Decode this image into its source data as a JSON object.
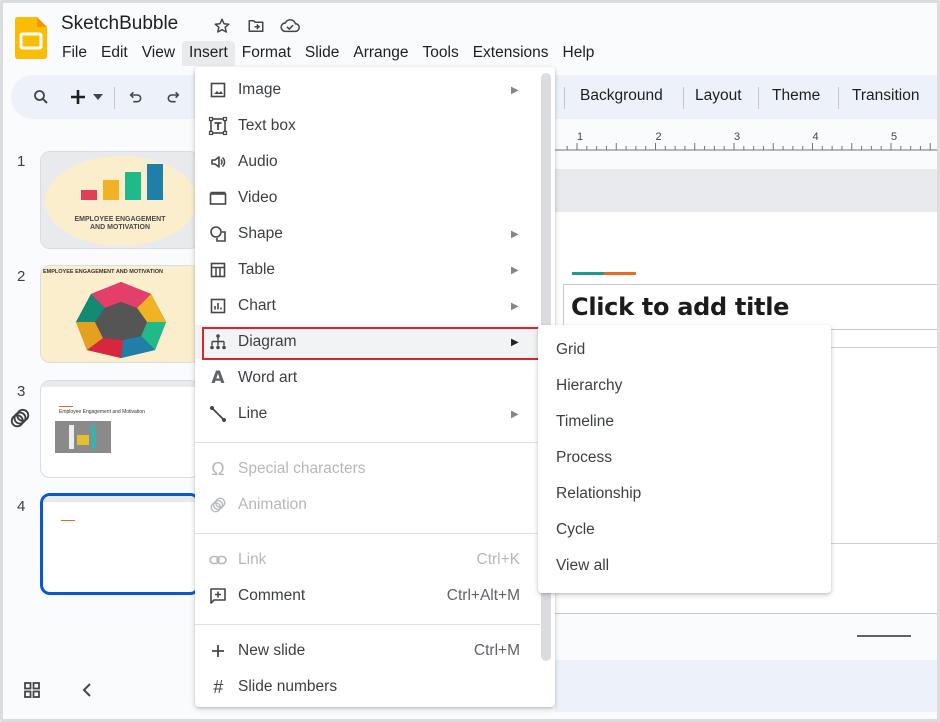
{
  "app": {
    "title": "SketchBubble",
    "title_icons": [
      "star-icon",
      "move-to-folder-icon",
      "cloud-saved-icon"
    ],
    "brand_color": "#fbbc04"
  },
  "menubar": {
    "items": [
      "File",
      "Edit",
      "View",
      "Insert",
      "Format",
      "Slide",
      "Arrange",
      "Tools",
      "Extensions",
      "Help"
    ],
    "active": "Insert"
  },
  "toolbar": {
    "icons": [
      "search-icon",
      "new-slide-plus-icon",
      "dropdown-caret-icon",
      "undo-icon",
      "redo-icon"
    ],
    "background_label": "Background",
    "layout_label": "Layout",
    "theme_label": "Theme",
    "transition_label": "Transition"
  },
  "ruler": {
    "ticks": [
      "1",
      "2",
      "3",
      "4",
      "5"
    ]
  },
  "slide": {
    "title_placeholder": "Click to add title",
    "accent_colors": [
      "#1e9a8c",
      "#e8692a"
    ]
  },
  "filmstrip": {
    "slides": [
      {
        "number": "1",
        "caption": "EMPLOYEE ENGAGEMENT AND MOTIVATION"
      },
      {
        "number": "2",
        "caption": "EMPLOYEE ENGAGEMENT AND MOTIVATION",
        "center_text": "EMPLOYEE ENGAGEMENT AND MOTIVATION"
      },
      {
        "number": "3",
        "caption": "Employee Engagement and Motivation",
        "has_animation": true
      },
      {
        "number": "4",
        "caption": "",
        "selected": true
      }
    ],
    "selected_color": "#0b57d0"
  },
  "insert_menu": {
    "items": [
      {
        "label": "Image",
        "icon": "image-icon",
        "submenu": true
      },
      {
        "label": "Text box",
        "icon": "text-box-icon"
      },
      {
        "label": "Audio",
        "icon": "audio-icon"
      },
      {
        "label": "Video",
        "icon": "video-icon"
      },
      {
        "label": "Shape",
        "icon": "shape-icon",
        "submenu": true
      },
      {
        "label": "Table",
        "icon": "table-icon",
        "submenu": true
      },
      {
        "label": "Chart",
        "icon": "chart-icon",
        "submenu": true
      },
      {
        "label": "Diagram",
        "icon": "diagram-icon",
        "submenu": true,
        "highlighted": true
      },
      {
        "label": "Word art",
        "icon": "word-art-icon"
      },
      {
        "label": "Line",
        "icon": "line-icon",
        "submenu": true
      },
      {
        "label": "Special characters",
        "icon": "omega-icon",
        "disabled": true
      },
      {
        "label": "Animation",
        "icon": "animation-icon",
        "disabled": true
      },
      {
        "label": "Link",
        "icon": "link-icon",
        "disabled": true,
        "shortcut": "Ctrl+K"
      },
      {
        "label": "Comment",
        "icon": "comment-icon",
        "shortcut": "Ctrl+Alt+M"
      },
      {
        "label": "New slide",
        "icon": "plus-icon",
        "shortcut": "Ctrl+M"
      },
      {
        "label": "Slide numbers",
        "icon": "hash-icon"
      }
    ],
    "highlight_border_color": "#d9262e"
  },
  "diagram_submenu": {
    "items": [
      "Grid",
      "Hierarchy",
      "Timeline",
      "Process",
      "Relationship",
      "Cycle",
      "View all"
    ]
  }
}
